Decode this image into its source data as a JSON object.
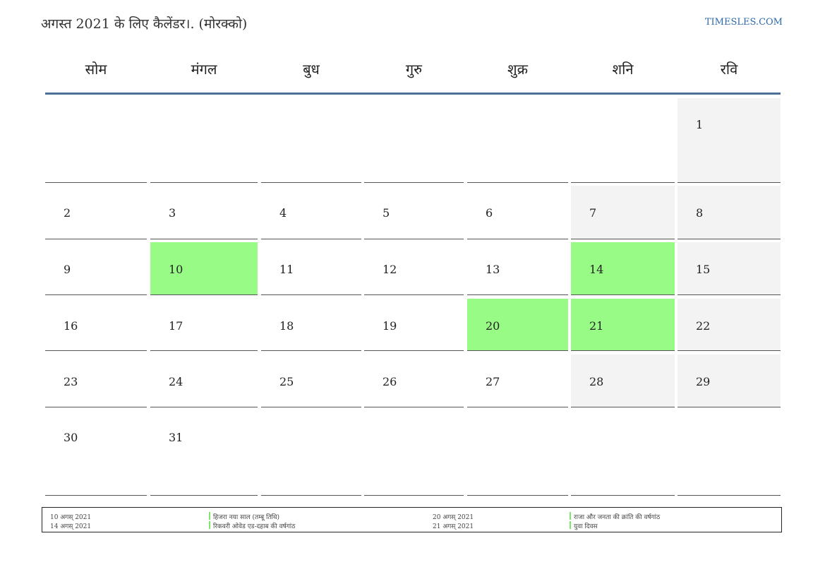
{
  "title": "अगस्त 2021 के लिए कैलेंडर।. (मोरक्को)",
  "site": "TIMESLES.COM",
  "weekdays": [
    "सोम",
    "मंगल",
    "बुध",
    "गुरु",
    "शुक्र",
    "शनि",
    "रवि"
  ],
  "colors": {
    "accent": "#4e7096",
    "holiday": "#98fb86",
    "weekend": "#f3f3f3",
    "link": "#2f6aa8"
  },
  "calendar": {
    "weeks": [
      [
        null,
        null,
        null,
        null,
        null,
        null,
        1
      ],
      [
        2,
        3,
        4,
        5,
        6,
        7,
        8
      ],
      [
        9,
        10,
        11,
        12,
        13,
        14,
        15
      ],
      [
        16,
        17,
        18,
        19,
        20,
        21,
        22
      ],
      [
        23,
        24,
        25,
        26,
        27,
        28,
        29
      ],
      [
        30,
        31,
        null,
        null,
        null,
        null,
        null
      ]
    ],
    "holidays": [
      10,
      14,
      20,
      21
    ]
  },
  "legend": [
    {
      "date": "10 अगस् 2021",
      "name": "हिजरा नया साल (तम्बू तिथि)"
    },
    {
      "date": "14 अगस् 2021",
      "name": "रिकवरी ओवेड एड-दहाब की वर्षगांठ"
    },
    {
      "date": "20 अगस् 2021",
      "name": "राजा और जनता की क्रांति की वर्षगांठ"
    },
    {
      "date": "21 अगस् 2021",
      "name": "युवा दिवस"
    }
  ]
}
